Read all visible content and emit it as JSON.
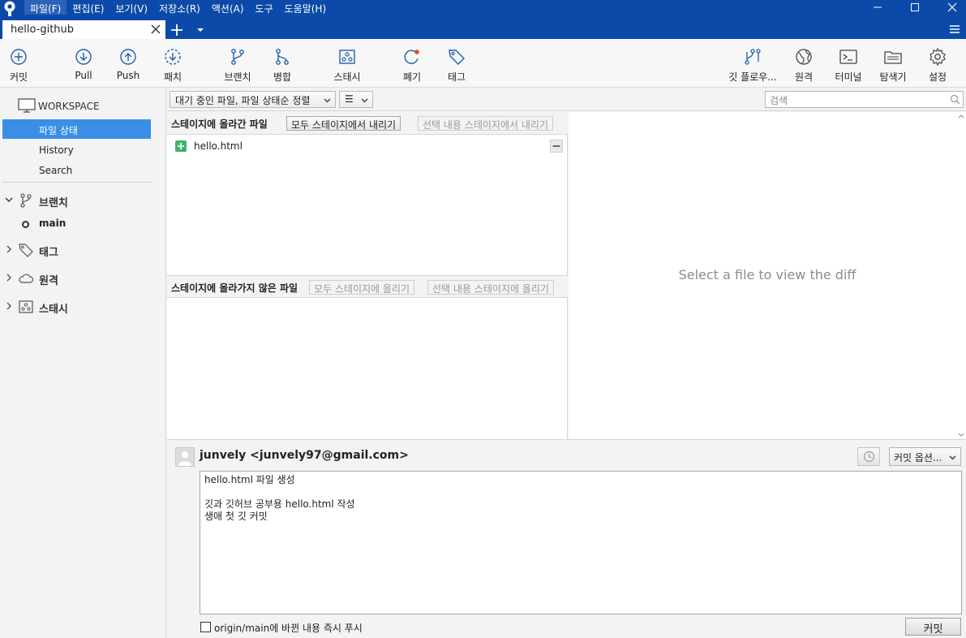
{
  "menu": {
    "items": [
      "파일(F)",
      "편집(E)",
      "보기(V)",
      "저장소(R)",
      "액션(A)",
      "도구",
      "도움말(H)"
    ]
  },
  "tab": {
    "label": "hello-github"
  },
  "toolbar": {
    "commit": "커밋",
    "pull": "Pull",
    "push": "Push",
    "fetch": "패치",
    "branch": "브랜치",
    "merge": "병합",
    "stash": "스태시",
    "discard": "폐기",
    "tag": "태그",
    "gitflow": "깃 플로우...",
    "remote": "원격",
    "terminal": "터미널",
    "explorer": "탐색기",
    "settings": "설정"
  },
  "sidebar": {
    "workspace": "WORKSPACE",
    "file_status": "파일 상태",
    "history": "History",
    "search": "Search",
    "branches": "브랜치",
    "branch_main": "main",
    "tags": "태그",
    "remotes": "원격",
    "stashes": "스태시"
  },
  "filter": {
    "sort_select": "대기 중인 파일, 파일 상태순 정렬",
    "view_select": "☰",
    "search_placeholder": "검색"
  },
  "staged": {
    "title": "스테이지에 올라간 파일",
    "unstage_all": "모두 스테이지에서 내리기",
    "unstage_selected": "선택 내용 스테이지에서 내리기",
    "files": [
      {
        "name": "hello.html"
      }
    ]
  },
  "unstaged": {
    "title": "스테이지에 올라가지 않은 파일",
    "stage_all": "모두 스테이지에 올리기",
    "stage_selected": "선택 내용 스테이지에 올리기"
  },
  "diff": {
    "placeholder": "Select a file to view the diff"
  },
  "commit": {
    "author": "junvely <junvely97@gmail.com>",
    "options": "커밋 옵션...",
    "message_lines": [
      "hello.html 파일 생성",
      "",
      "깃과 깃허브 공부용 hello.html 작성",
      "생애 첫 깃 커밋"
    ],
    "push_label": "origin/main에 바뀐 내용 즉시 푸시",
    "button": "커밋"
  },
  "colors": {
    "titlebar": "#0b4aa8",
    "selection": "#3a8ee6",
    "toolbar_icon": "#1f5fb0",
    "added_file": "#3bb36b",
    "discard_dot": "#e84b1e"
  }
}
